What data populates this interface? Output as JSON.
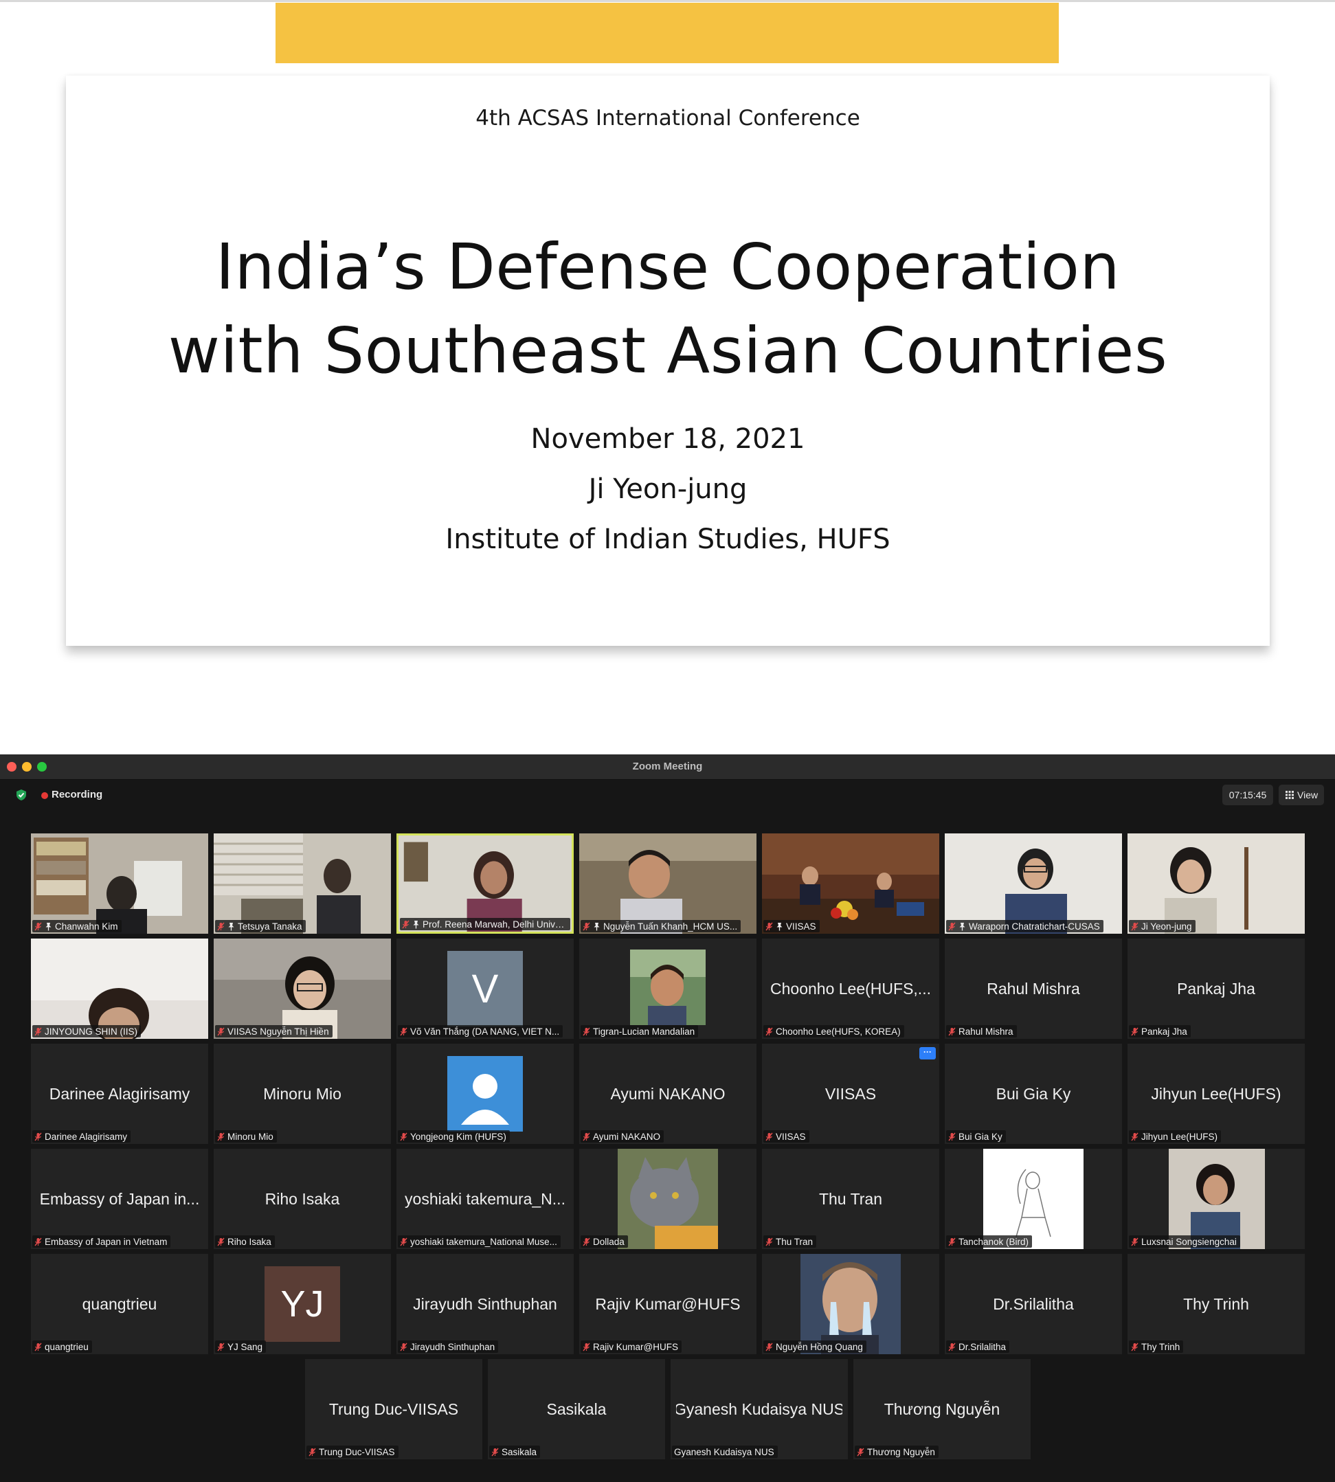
{
  "slide": {
    "conference": "4th ACSAS International Conference",
    "title_line1": "India’s Defense Cooperation",
    "title_line2": "with Southeast Asian Countries",
    "date": "November 18, 2021",
    "author": "Ji Yeon-jung",
    "affiliation": "Institute of Indian Studies, HUFS",
    "accent_color": "#f5c242"
  },
  "window": {
    "title": "Zoom Meeting",
    "recording_label": "Recording",
    "timer": "07:15:45",
    "view_label": "View"
  },
  "rows": [
    [
      {
        "display": "",
        "name": "Chanwahn Kim",
        "kind": "video",
        "bg": "office",
        "pinned": true
      },
      {
        "display": "",
        "name": "Tetsuya Tanaka",
        "kind": "video",
        "bg": "office2",
        "pinned": true
      },
      {
        "display": "",
        "name": "Prof. Reena Marwah, Delhi Univer...",
        "kind": "video",
        "bg": "speaker",
        "pinned": true,
        "active": true
      },
      {
        "display": "",
        "name": "Nguyễn Tuấn Khanh_HCM US...",
        "kind": "video",
        "bg": "man",
        "pinned": true
      },
      {
        "display": "",
        "name": "VIISAS",
        "kind": "video",
        "bg": "stage",
        "pinned": true
      },
      {
        "display": "",
        "name": "Waraporn Chatratichart-CUSAS",
        "kind": "video",
        "bg": "woman",
        "pinned": true
      },
      {
        "display": "",
        "name": "Ji Yeon-jung",
        "kind": "video",
        "bg": "woman2",
        "pinned": false
      }
    ],
    [
      {
        "display": "",
        "name": "JINYOUNG SHIN (IIS)",
        "kind": "video",
        "bg": "bright"
      },
      {
        "display": "",
        "name": "VIISAS Nguyễn Thị Hiền",
        "kind": "video",
        "bg": "woman3"
      },
      {
        "display": "V",
        "name": "Võ Văn Thắng (DA NANG, VIET N...",
        "kind": "letter",
        "color": "#6f7f8e"
      },
      {
        "display": "",
        "name": "Tigran-Lucian Mandalian",
        "kind": "photo",
        "bg": "photo-man"
      },
      {
        "display": "Choonho Lee(HUFS,...",
        "name": "Choonho Lee(HUFS, KOREA)",
        "kind": "text"
      },
      {
        "display": "Rahul Mishra",
        "name": "Rahul Mishra",
        "kind": "text"
      },
      {
        "display": "Pankaj Jha",
        "name": "Pankaj Jha",
        "kind": "text"
      }
    ],
    [
      {
        "display": "Darinee Alagirisamy",
        "name": "Darinee Alagirisamy",
        "kind": "text"
      },
      {
        "display": "Minoru Mio",
        "name": "Minoru Mio",
        "kind": "text"
      },
      {
        "display": "",
        "name": "Yongjeong Kim (HUFS)",
        "kind": "default-avatar",
        "color": "#3d8fd8"
      },
      {
        "display": "Ayumi NAKANO",
        "name": "Ayumi NAKANO",
        "kind": "text"
      },
      {
        "display": "VIISAS",
        "name": "VIISAS",
        "kind": "text",
        "more": "···"
      },
      {
        "display": "Bui Gia Ky",
        "name": "Bui Gia Ky",
        "kind": "text"
      },
      {
        "display": "Jihyun Lee(HUFS)",
        "name": "Jihyun Lee(HUFS)",
        "kind": "text"
      }
    ],
    [
      {
        "display": "Embassy of Japan in...",
        "name": "Embassy of Japan in Vietnam",
        "kind": "text"
      },
      {
        "display": "Riho Isaka",
        "name": "Riho Isaka",
        "kind": "text"
      },
      {
        "display": "yoshiaki takemura_N...",
        "name": "yoshiaki takemura_National Muse...",
        "kind": "text"
      },
      {
        "display": "",
        "name": "Dollada",
        "kind": "photo",
        "bg": "cat"
      },
      {
        "display": "Thu Tran",
        "name": "Thu Tran",
        "kind": "text"
      },
      {
        "display": "",
        "name": "Tanchanok (Bird)",
        "kind": "photo",
        "bg": "sketch"
      },
      {
        "display": "",
        "name": "Luxsnai Songsiengchai",
        "kind": "photo",
        "bg": "photo-woman"
      }
    ],
    [
      {
        "display": "quangtrieu",
        "name": "quangtrieu",
        "kind": "text"
      },
      {
        "display": "YJ",
        "name": "YJ Sang",
        "kind": "letter",
        "color": "#5a3d35"
      },
      {
        "display": "Jirayudh Sinthuphan",
        "name": "Jirayudh Sinthuphan",
        "kind": "text"
      },
      {
        "display": "Rajiv Kumar@HUFS",
        "name": "Rajiv Kumar@HUFS",
        "kind": "text"
      },
      {
        "display": "",
        "name": "Nguyễn Hồng Quang",
        "kind": "photo",
        "bg": "photo-crying"
      },
      {
        "display": "Dr.Srilalitha",
        "name": "Dr.Srilalitha",
        "kind": "text"
      },
      {
        "display": "Thy Trinh",
        "name": "Thy Trinh",
        "kind": "text"
      }
    ],
    [
      {
        "display": "Trung Duc-VIISAS",
        "name": "Trung Duc-VIISAS",
        "kind": "text"
      },
      {
        "display": "Sasikala",
        "name": "Sasikala",
        "kind": "text"
      },
      {
        "display": "Gyanesh Kudaisya NUS",
        "name": "Gyanesh Kudaisya NUS",
        "kind": "text",
        "unmuted": true
      },
      {
        "display": "Thương Nguyễn",
        "name": "Thương Nguyễn",
        "kind": "text"
      }
    ]
  ]
}
